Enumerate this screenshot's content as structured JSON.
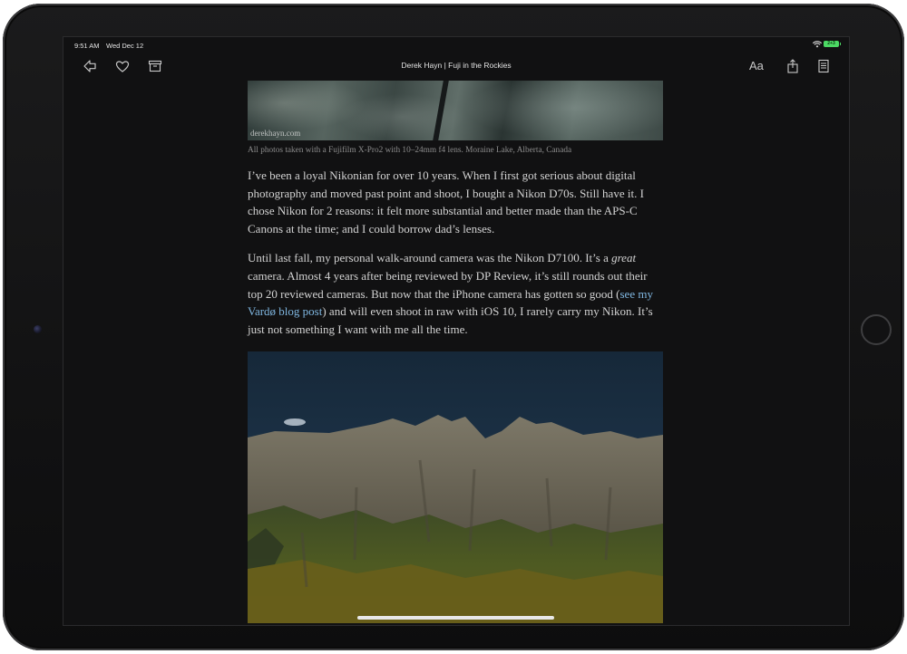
{
  "status_bar": {
    "time": "9:51 AM",
    "date": "Wed Dec 12",
    "battery_label": "2+3"
  },
  "toolbar": {
    "title": "Derek Hayn | Fuji in the Rockies",
    "font_button_label": "Aa",
    "icons": [
      "back-icon",
      "heart-icon",
      "archive-icon",
      "share-icon",
      "reader-list-icon"
    ]
  },
  "article": {
    "photo1_watermark": "derekhayn.com",
    "caption": "All photos taken with a Fujifilm X-Pro2 with 10–24mm f4 lens. Moraine Lake, Alberta, Canada",
    "p1": "I’ve been a loyal Nikonian for over 10 years. When I first got serious about digital photography and moved past point and shoot, I bought a Nikon D70s. Still have it. I chose Nikon for 2 reasons: it felt more substantial and better made than the APS-C Canons at the time; and I could borrow dad’s lenses.",
    "p2_a": "Until last fall, my personal walk-around camera was the Nikon D7100. It’s a ",
    "p2_em": "great",
    "p2_b": " camera. Almost 4 years after being reviewed by DP Review, it’s still rounds out their top 20 reviewed cameras. But now that the iPhone camera has gotten so good (",
    "p2_link": "see my Vardø blog post",
    "p2_c": ") and will even shoot in raw with iOS 10, I rarely carry my Nikon. It’s just not something I want with me all the time."
  },
  "colors": {
    "background": "#111112",
    "link": "#7fb6e0",
    "text": "#d2d2d2",
    "caption": "#8c8c8c"
  }
}
